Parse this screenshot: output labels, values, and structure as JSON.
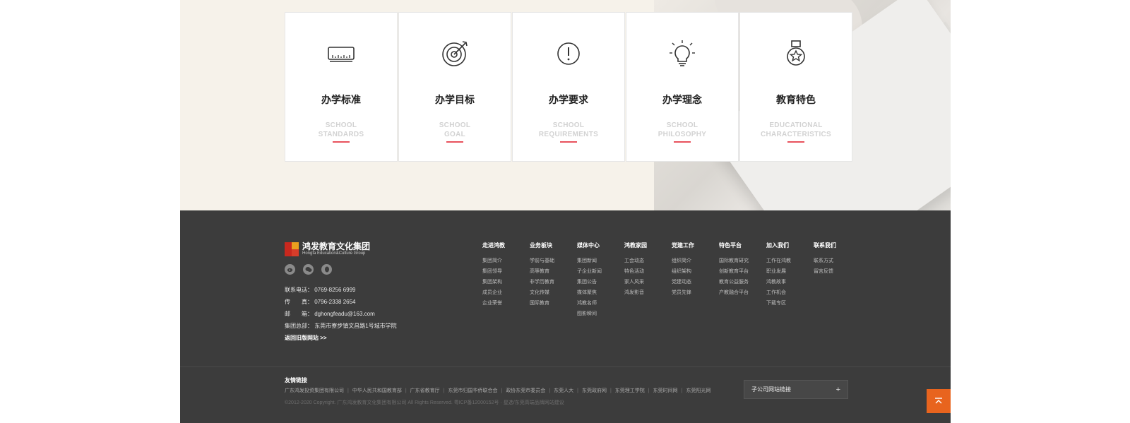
{
  "cards": [
    {
      "title": "办学标准",
      "en1": "SCHOOL",
      "en2": "STANDARDS",
      "icon": "ruler-icon"
    },
    {
      "title": "办学目标",
      "en1": "SCHOOL",
      "en2": "GOAL",
      "icon": "target-icon"
    },
    {
      "title": "办学要求",
      "en1": "SCHOOL",
      "en2": "REQUIREMENTS",
      "icon": "exclamation-icon"
    },
    {
      "title": "办学理念",
      "en1": "SCHOOL",
      "en2": "PHILOSOPHY",
      "icon": "lightbulb-icon"
    },
    {
      "title": "教育特色",
      "en1": "EDUCATIONAL",
      "en2": "CHARACTERISTICS",
      "icon": "medal-icon"
    }
  ],
  "footer": {
    "logo_cn": "鸿发教育文化集团",
    "logo_en": "Hongfa Education&Culture Group",
    "socials": [
      "weibo-icon",
      "wechat-icon",
      "qq-icon"
    ],
    "contact": {
      "phone": "联系电话： 0769-8256 6999",
      "fax": "传　　真： 0796-2338 2654",
      "email": "邮　　箱： dghongfeadu@163.com",
      "address": "集团总部： 东莞市寮步镇文昌路1号城市学院",
      "back": "返回旧版网站 >>"
    },
    "nav": [
      {
        "head": "走进鸿教",
        "items": [
          "集团简介",
          "集团领导",
          "集团架构",
          "成员企业",
          "企业荣誉"
        ]
      },
      {
        "head": "业务板块",
        "items": [
          "学前与基础",
          "高等教育",
          "非学历教育",
          "文化传媒",
          "国际教育"
        ]
      },
      {
        "head": "媒体中心",
        "items": [
          "集团新闻",
          "子企业新闻",
          "集团公告",
          "媒体聚焦",
          "鸿教名师",
          "图影瞬间"
        ]
      },
      {
        "head": "鸿教家园",
        "items": [
          "工会动态",
          "特色活动",
          "家人风采",
          "鸿发影音"
        ]
      },
      {
        "head": "党建工作",
        "items": [
          "组织简介",
          "组织架构",
          "党建动态",
          "党员先锋"
        ]
      },
      {
        "head": "特色平台",
        "items": [
          "国际教育研究",
          "创新教育平台",
          "教育公益服务",
          "产教融合平台"
        ]
      },
      {
        "head": "加入我们",
        "items": [
          "工作在鸿教",
          "职业发展",
          "鸿教故事",
          "工作机会",
          "下载专区"
        ]
      },
      {
        "head": "联系我们",
        "items": [
          "联系方式",
          "留言反馈"
        ]
      }
    ],
    "friend_title": "友情链接",
    "friend_links": [
      "广东鸿发投资集团有限公司",
      "中华人民共和国教育部",
      "广东省教育厅",
      "东莞市归国华侨联合会",
      "政协东莞市委员会",
      "东莞人大",
      "东莞政府网",
      "东莞理工学院",
      "东莞时间网",
      "东莞阳光网"
    ],
    "copyright": "©2012-2020 Copyright. 广东鸿发教育文化集团有限公司 All Rights Reserved. 粤ICP备12000152号 · 星选/东莞高端品牌网站建设",
    "sub_select_label": "子公司网站链接",
    "sub_select_icon": "plus-icon",
    "totop_icon": "arrow-up-icon"
  }
}
